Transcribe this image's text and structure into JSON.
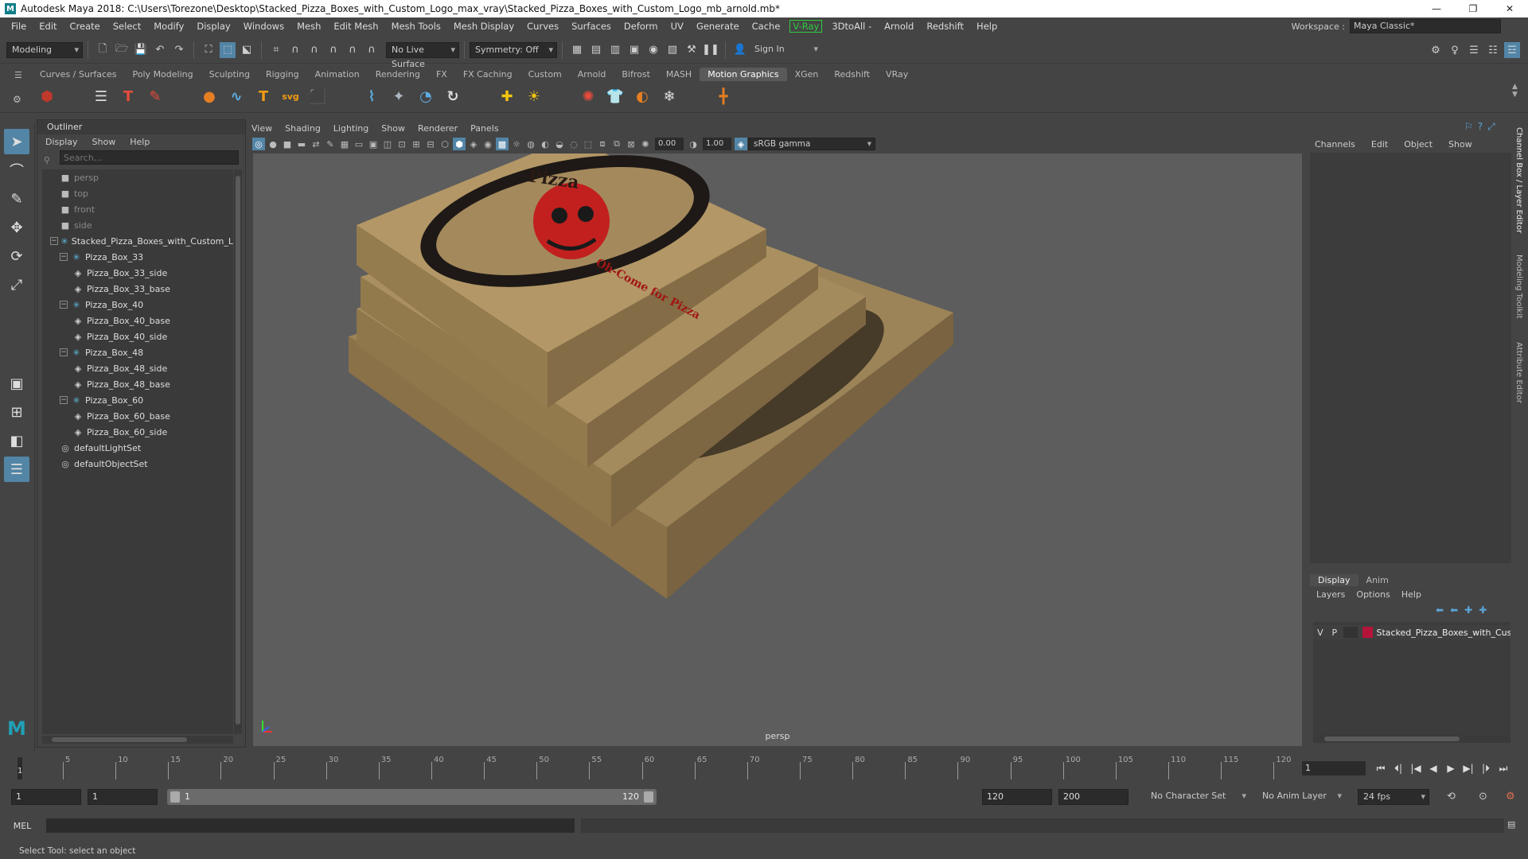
{
  "window": {
    "title": "Autodesk Maya 2018: C:\\Users\\Torezone\\Desktop\\Stacked_Pizza_Boxes_with_Custom_Logo_max_vray\\Stacked_Pizza_Boxes_with_Custom_Logo_mb_arnold.mb*",
    "logo": "M",
    "minimize": "—",
    "maximize": "❐",
    "close": "✕"
  },
  "menubar": {
    "items": [
      "File",
      "Edit",
      "Create",
      "Select",
      "Modify",
      "Display",
      "Windows",
      "Mesh",
      "Edit Mesh",
      "Mesh Tools",
      "Mesh Display",
      "Curves",
      "Surfaces",
      "Deform",
      "UV",
      "Generate",
      "Cache"
    ],
    "vray": "V-Ray",
    "items2": [
      "3DtoAll -",
      "Arnold",
      "Redshift",
      "Help"
    ],
    "workspace_label": "Workspace :",
    "workspace_value": "Maya Classic*"
  },
  "statusline": {
    "mode": "Modeling",
    "live_surface": "No Live Surface",
    "symmetry": "Symmetry: Off",
    "sign_in": "Sign In"
  },
  "shelf": {
    "tabs": [
      "Curves / Surfaces",
      "Poly Modeling",
      "Sculpting",
      "Rigging",
      "Animation",
      "Rendering",
      "FX",
      "FX Caching",
      "Custom",
      "Arnold",
      "Bifrost",
      "MASH",
      "Motion Graphics",
      "XGen",
      "Redshift",
      "VRay"
    ],
    "active_tab": "Motion Graphics"
  },
  "outliner": {
    "title": "Outliner",
    "menu": [
      "Display",
      "Show",
      "Help"
    ],
    "search_placeholder": "Search...",
    "nodes": {
      "persp": "persp",
      "top": "top",
      "front": "front",
      "side": "side",
      "root": "Stacked_Pizza_Boxes_with_Custom_Lo",
      "box33": "Pizza_Box_33",
      "box33_side": "Pizza_Box_33_side",
      "box33_base": "Pizza_Box_33_base",
      "box40": "Pizza_Box_40",
      "box40_base": "Pizza_Box_40_base",
      "box40_side": "Pizza_Box_40_side",
      "box48": "Pizza_Box_48",
      "box48_side": "Pizza_Box_48_side",
      "box48_base": "Pizza_Box_48_base",
      "box60": "Pizza_Box_60",
      "box60_base": "Pizza_Box_60_base",
      "box60_side": "Pizza_Box_60_side",
      "light_set": "defaultLightSet",
      "object_set": "defaultObjectSet"
    }
  },
  "viewport": {
    "menu": [
      "View",
      "Shading",
      "Lighting",
      "Show",
      "Renderer",
      "Panels"
    ],
    "exposure": "0.00",
    "gamma": "1.00",
    "color_space": "sRGB gamma",
    "camera": "persp",
    "logo_text_top": "Pizza",
    "logo_text_bottom": "Oh-Come for Pizza"
  },
  "channelbox": {
    "menu": [
      "Channels",
      "Edit",
      "Object",
      "Show"
    ],
    "side_tabs": [
      "Channel Box / Layer Editor",
      "Modeling Toolkit",
      "Attribute Editor"
    ]
  },
  "layereditor": {
    "tabs": [
      "Display",
      "Anim"
    ],
    "active_tab": "Display",
    "menu": [
      "Layers",
      "Options",
      "Help"
    ],
    "layer": {
      "v": "V",
      "p": "P",
      "name": "Stacked_Pizza_Boxes_with_Cus",
      "color": "#b5143a"
    }
  },
  "timeline": {
    "ticks": [
      5,
      10,
      15,
      20,
      25,
      30,
      35,
      40,
      45,
      50,
      55,
      60,
      65,
      70,
      75,
      80,
      85,
      90,
      95,
      100,
      105,
      110,
      115,
      120
    ],
    "start_tick": "1",
    "current_frame": "1",
    "controls": [
      "⏮",
      "⏴|",
      "|◀",
      "◀",
      "▶",
      "▶|",
      "|⏵",
      "⏭"
    ]
  },
  "range": {
    "start": "1",
    "playback_start": "1",
    "slider_start": "1",
    "slider_end": "120",
    "playback_end": "120",
    "end": "200",
    "character_set": "No Character Set",
    "anim_layer": "No Anim Layer",
    "fps": "24 fps"
  },
  "mel": {
    "label": "MEL",
    "help": "Select Tool: select an object"
  }
}
